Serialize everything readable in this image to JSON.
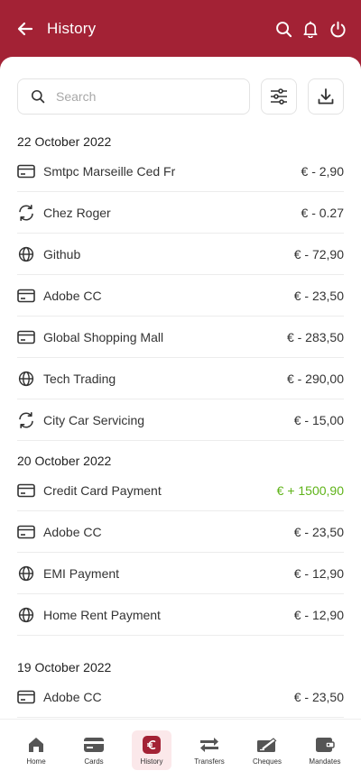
{
  "header": {
    "title": "History"
  },
  "search": {
    "placeholder": "Search"
  },
  "groups": [
    {
      "date": "22 October 2022",
      "transactions": [
        {
          "icon": "card-icon",
          "name": "Smtpc Marseille Ced Fr",
          "amount": "€ - 2,90"
        },
        {
          "icon": "sync-icon",
          "name": "Chez Roger",
          "amount": "€ - 0.27"
        },
        {
          "icon": "globe-icon",
          "name": "Github",
          "amount": "€ - 72,90"
        },
        {
          "icon": "card-icon",
          "name": "Adobe CC",
          "amount": "€ - 23,50"
        },
        {
          "icon": "card-icon",
          "name": "Global Shopping Mall",
          "amount": "€ - 283,50"
        },
        {
          "icon": "globe-icon",
          "name": "Tech Trading",
          "amount": "€ - 290,00"
        },
        {
          "icon": "sync-icon",
          "name": "City Car Servicing",
          "amount": "€ - 15,00"
        }
      ]
    },
    {
      "date": "20 October 2022",
      "transactions": [
        {
          "icon": "card-icon",
          "name": "Credit Card Payment",
          "amount": "€ + 1500,90",
          "credit": true
        },
        {
          "icon": "card-icon",
          "name": "Adobe CC",
          "amount": "€ - 23,50"
        },
        {
          "icon": "globe-icon",
          "name": "EMI Payment",
          "amount": "€ - 12,90"
        },
        {
          "icon": "globe-icon",
          "name": "Home Rent Payment",
          "amount": "€ - 12,90"
        }
      ]
    },
    {
      "date": "19 October 2022",
      "transactions": [
        {
          "icon": "card-icon",
          "name": "Adobe CC",
          "amount": "€ - 23,50"
        }
      ]
    }
  ],
  "nav": {
    "items": [
      {
        "label": "Home",
        "icon": "home-icon"
      },
      {
        "label": "Cards",
        "icon": "cards-icon"
      },
      {
        "label": "History",
        "icon": "euro-icon",
        "active": true
      },
      {
        "label": "Transfers",
        "icon": "transfer-icon"
      },
      {
        "label": "Cheques",
        "icon": "cheque-icon"
      },
      {
        "label": "Mandates",
        "icon": "wallet-icon"
      }
    ]
  },
  "colors": {
    "brand": "#a32235",
    "credit": "#5fb319",
    "active_bg": "#fbe8ea"
  }
}
